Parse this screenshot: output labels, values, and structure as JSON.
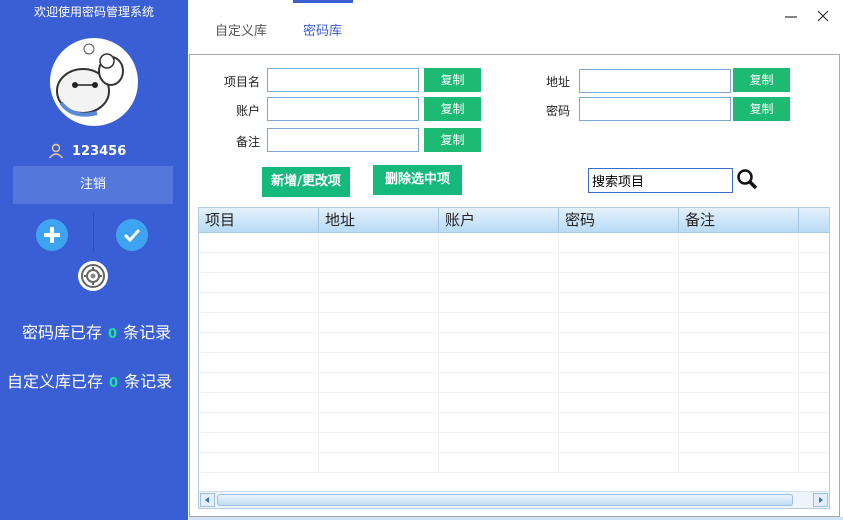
{
  "sidebar": {
    "welcome": "欢迎使用密码管理系统",
    "username": "123456",
    "logout_label": "注销",
    "stats": [
      {
        "prefix": "密码库已存",
        "count": "0",
        "suffix": "条记录"
      },
      {
        "prefix": "自定义库已存",
        "count": "0",
        "suffix": "条记录"
      }
    ]
  },
  "tabs": [
    {
      "label": "自定义库",
      "active": false
    },
    {
      "label": "密码库",
      "active": true
    }
  ],
  "form": {
    "project_label": "项目名",
    "account_label": "账户",
    "note_label": "备注",
    "address_label": "地址",
    "password_label": "密码",
    "copy_label": "复制",
    "project_value": "",
    "account_value": "",
    "note_value": "",
    "address_value": "",
    "password_value": ""
  },
  "actions": {
    "add_update_label": "新增/更改项",
    "delete_label": "删除选中项"
  },
  "search": {
    "value": "搜索项目"
  },
  "table": {
    "columns": [
      "项目",
      "地址",
      "账户",
      "密码",
      "备注"
    ],
    "rows": []
  },
  "colors": {
    "sidebar_bg": "#3a5fd4",
    "accent_green": "#1cba72",
    "count_green": "#19e39c",
    "active_tab": "#3b5fd0"
  }
}
